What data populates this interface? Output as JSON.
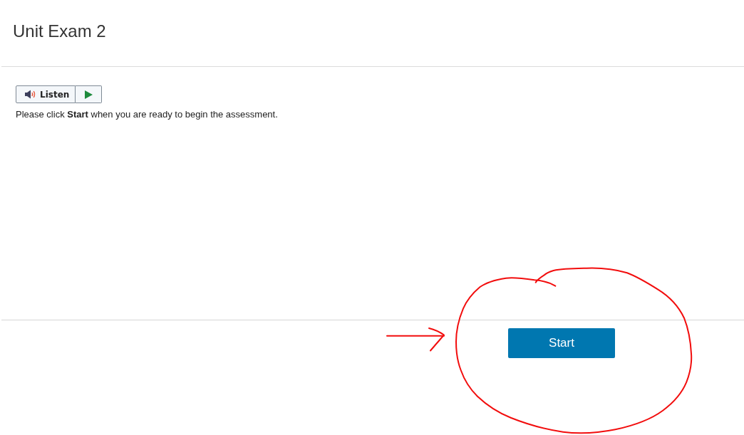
{
  "page": {
    "title": "Unit Exam 2"
  },
  "audio_toolbar": {
    "listen_label": "Listen"
  },
  "instructions": "Please click **Start** when you are ready to begin the assessment.",
  "footer": {
    "start_button": "Start"
  },
  "markup": {
    "circle_around_start": true,
    "arrow_to_start": true
  }
}
